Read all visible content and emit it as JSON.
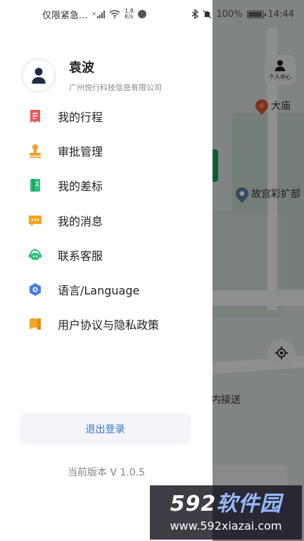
{
  "status_bar": {
    "notice": "仅限紧急...",
    "net_speed_value": "1.8",
    "net_speed_unit": "K/s",
    "battery": "100%",
    "time": "14:44"
  },
  "map": {
    "personal_center_label": "个人中心",
    "poi_1": "大庙",
    "poi_2": "故宫彩扩部",
    "route_hint": "内接送"
  },
  "drawer": {
    "user_name": "袁波",
    "company": "广州悦行科技信息有限公司",
    "menu": [
      {
        "label": "我的行程",
        "icon": "trip-icon",
        "color": "#e85a5a"
      },
      {
        "label": "审批管理",
        "icon": "approval-stamp-icon",
        "color": "#f0a030"
      },
      {
        "label": "我的差标",
        "icon": "travel-standard-icon",
        "color": "#2fbf7a"
      },
      {
        "label": "我的消息",
        "icon": "message-icon",
        "color": "#f5a623"
      },
      {
        "label": "联系客服",
        "icon": "customer-service-icon",
        "color": "#2fbf7a"
      },
      {
        "label": "语言/Language",
        "icon": "language-icon",
        "color": "#4a7be6"
      },
      {
        "label": "用户协议与隐私政策",
        "icon": "agreement-icon",
        "color": "#f5a623"
      }
    ],
    "logout_label": "退出登录",
    "version": "当前版本 V 1.0.5"
  },
  "watermark": {
    "brand_num": "592",
    "brand_text": "软件园",
    "url": "www.592xiazai.com"
  },
  "colors": {
    "accent_blue": "#3f73c9",
    "map_green": "#1e9e5a"
  }
}
